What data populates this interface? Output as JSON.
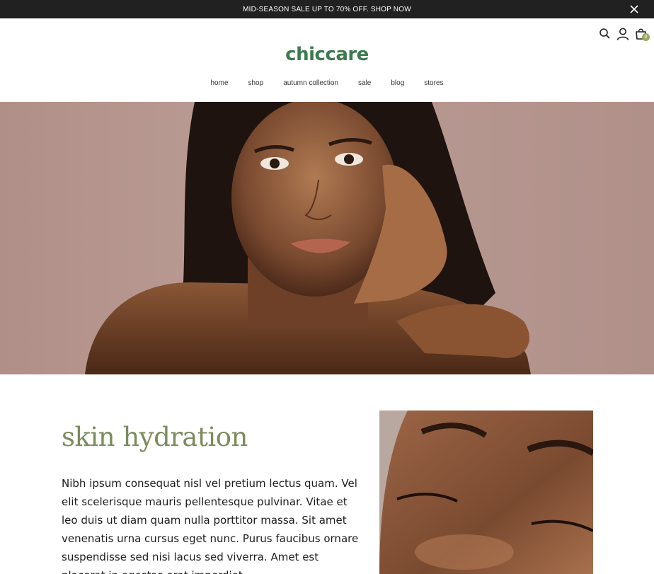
{
  "announcement": {
    "text": "MID-SEASON SALE UP TO 70% OFF. SHOP NOW",
    "close_icon": "close-icon"
  },
  "header": {
    "logo": "chiccare",
    "icons": [
      "search-icon",
      "user-icon",
      "cart-icon"
    ],
    "cart_count": "0",
    "colors": {
      "logo": "#3d7a4f",
      "badge": "#9aa95f"
    }
  },
  "nav": {
    "items": [
      {
        "label": "home"
      },
      {
        "label": "shop"
      },
      {
        "label": "autumn collection"
      },
      {
        "label": "sale"
      },
      {
        "label": "blog"
      },
      {
        "label": "stores"
      }
    ]
  },
  "content": {
    "heading": "skin hydration",
    "paragraph": "Nibh ipsum consequat nisl vel pretium lectus quam. Vel elit scelerisque mauris pellentesque pulvinar. Vitae et leo duis ut diam quam nulla porttitor massa. Sit amet venenatis urna cursus eget nunc. Purus faucibus ornare suspendisse sed nisi lacus sed viverra. Amet est placerat in egestas erat imperdiet",
    "heading_color": "#7a8c5d"
  }
}
